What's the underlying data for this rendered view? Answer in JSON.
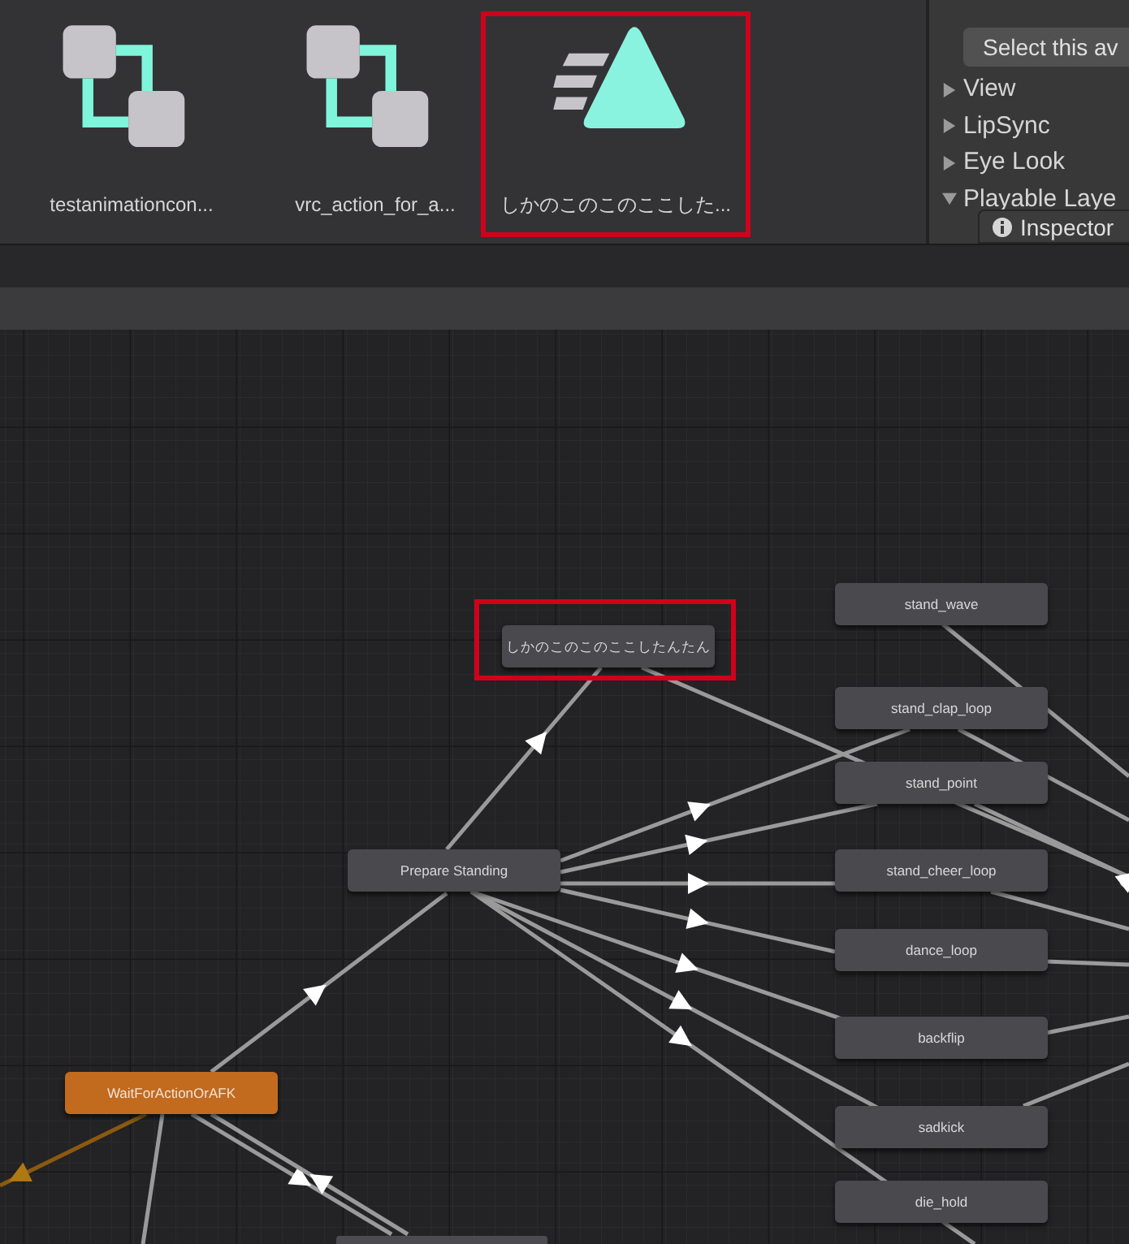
{
  "assets": [
    {
      "label": "testanimationcon...",
      "kind": "controller",
      "highlighted": false
    },
    {
      "label": "vrc_action_for_a...",
      "kind": "controller",
      "highlighted": false
    },
    {
      "label": "しかのこのこのここした...",
      "kind": "clip",
      "highlighted": true
    }
  ],
  "inspector_panel": {
    "select_button": "Select this av",
    "sections": [
      {
        "label": "View",
        "expanded": false
      },
      {
        "label": "LipSync",
        "expanded": false
      },
      {
        "label": "Eye Look",
        "expanded": false
      },
      {
        "label": "Playable Laye",
        "expanded": true
      }
    ],
    "tab": "Inspector"
  },
  "graph": {
    "states": [
      {
        "label": "しかのこのこのここしたんたん",
        "kind": "normal",
        "highlighted": true
      },
      {
        "label": "stand_wave",
        "kind": "normal",
        "highlighted": false
      },
      {
        "label": "stand_clap_loop",
        "kind": "normal",
        "highlighted": false
      },
      {
        "label": "stand_point",
        "kind": "normal",
        "highlighted": false
      },
      {
        "label": "stand_cheer_loop",
        "kind": "normal",
        "highlighted": false
      },
      {
        "label": "dance_loop",
        "kind": "normal",
        "highlighted": false
      },
      {
        "label": "backflip",
        "kind": "normal",
        "highlighted": false
      },
      {
        "label": "sadkick",
        "kind": "normal",
        "highlighted": false
      },
      {
        "label": "die_hold",
        "kind": "normal",
        "highlighted": false
      },
      {
        "label": "Prepare Standing",
        "kind": "normal",
        "highlighted": false
      },
      {
        "label": "WaitForActionOrAFK",
        "kind": "default",
        "highlighted": false
      }
    ]
  }
}
